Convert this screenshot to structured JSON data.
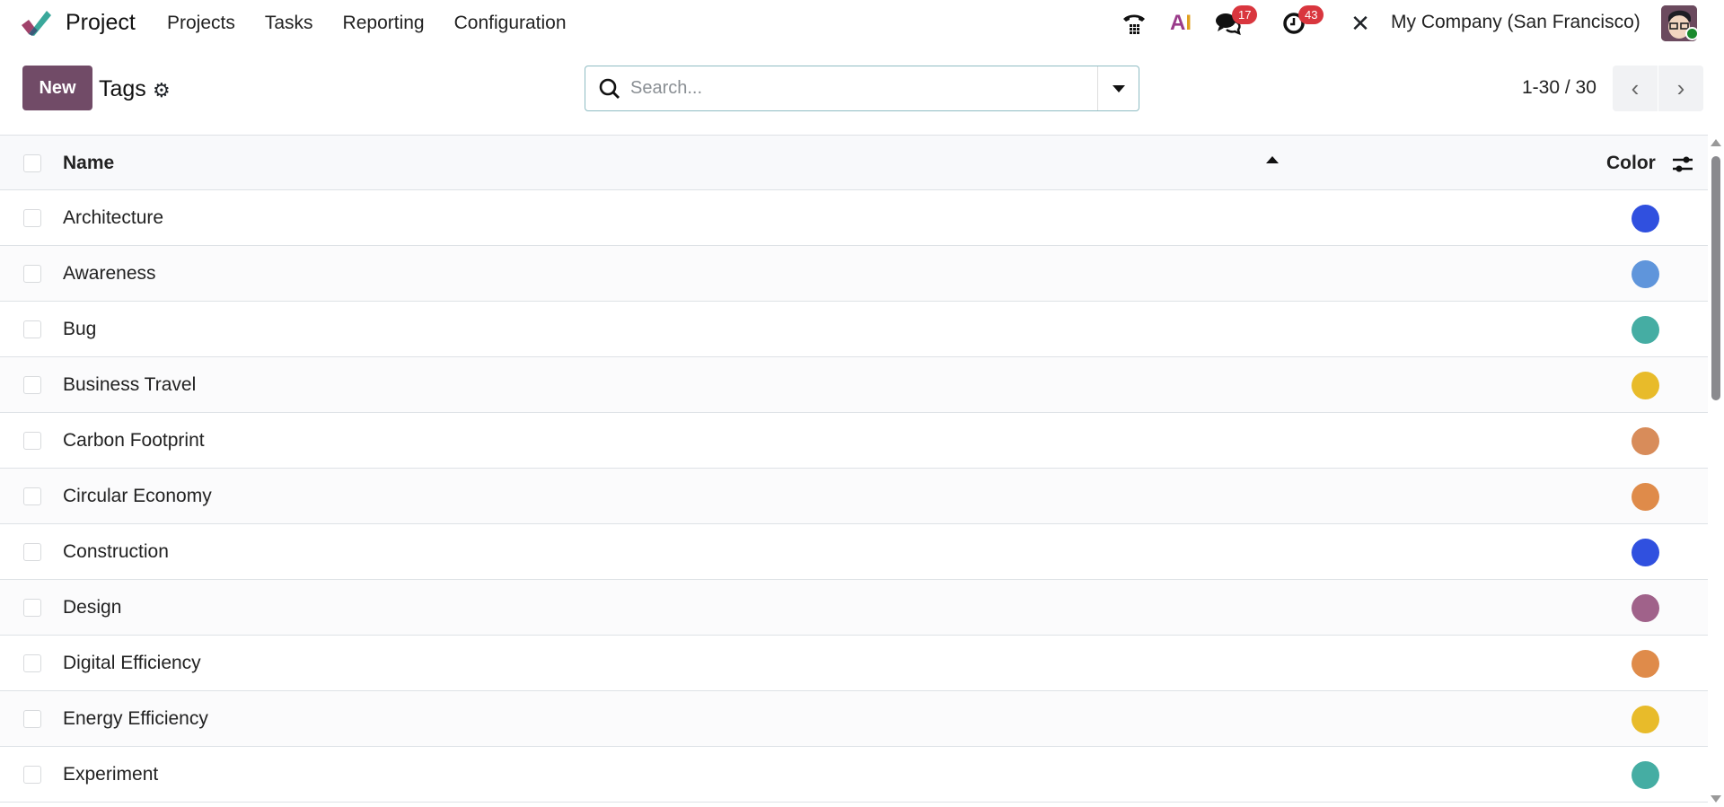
{
  "nav": {
    "app_name": "Project",
    "menu": [
      "Projects",
      "Tasks",
      "Reporting",
      "Configuration"
    ],
    "messages_count": "17",
    "activities_count": "43",
    "company": "My Company (San Francisco)",
    "ai_label": "AI"
  },
  "control": {
    "new_label": "New",
    "title": "Tags",
    "search_placeholder": "Search...",
    "pager": "1-30 / 30"
  },
  "table": {
    "headers": {
      "name": "Name",
      "color": "Color"
    },
    "rows": [
      {
        "name": "Architecture",
        "color": "#3050df"
      },
      {
        "name": "Awareness",
        "color": "#5f95db"
      },
      {
        "name": "Bug",
        "color": "#45ada3"
      },
      {
        "name": "Business Travel",
        "color": "#e8bb2a"
      },
      {
        "name": "Carbon Footprint",
        "color": "#d88c5a"
      },
      {
        "name": "Circular Economy",
        "color": "#df8b4a"
      },
      {
        "name": "Construction",
        "color": "#3050df"
      },
      {
        "name": "Design",
        "color": "#a0628a"
      },
      {
        "name": "Digital Efficiency",
        "color": "#df8b4a"
      },
      {
        "name": "Energy Efficiency",
        "color": "#e8bb2a"
      },
      {
        "name": "Experiment",
        "color": "#45ada3"
      }
    ]
  }
}
